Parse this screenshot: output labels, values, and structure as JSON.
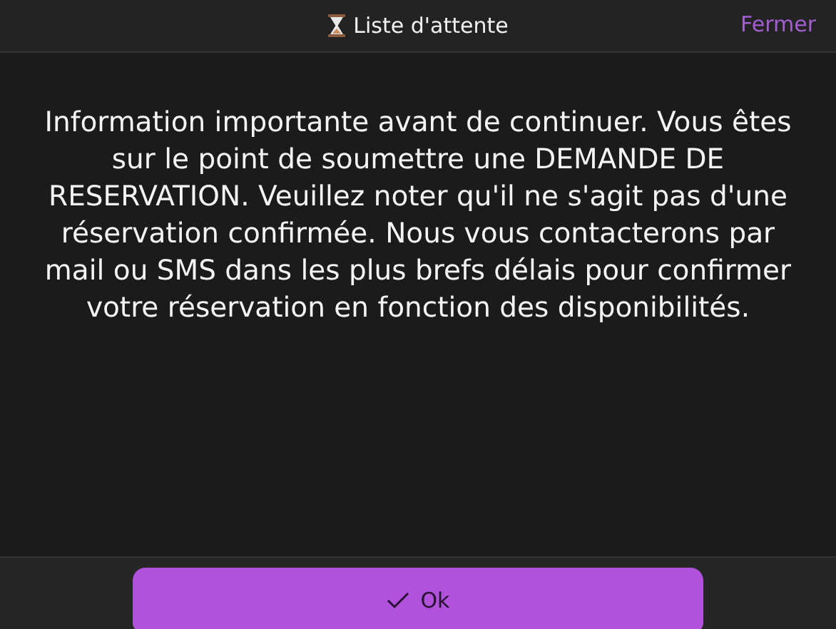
{
  "header": {
    "title": "Liste d'attente",
    "close_link": "Fermer"
  },
  "message": "Information importante avant de continuer. Vous êtes sur le point de soumettre une DEMANDE DE RESERVATION. Veuillez noter qu'il ne s'agit pas d'une réservation confirmée. Nous vous contacterons par mail ou SMS dans les plus brefs délais pour confirmer votre réservation en fonction des disponibilités.",
  "footer": {
    "button": "Ok"
  }
}
